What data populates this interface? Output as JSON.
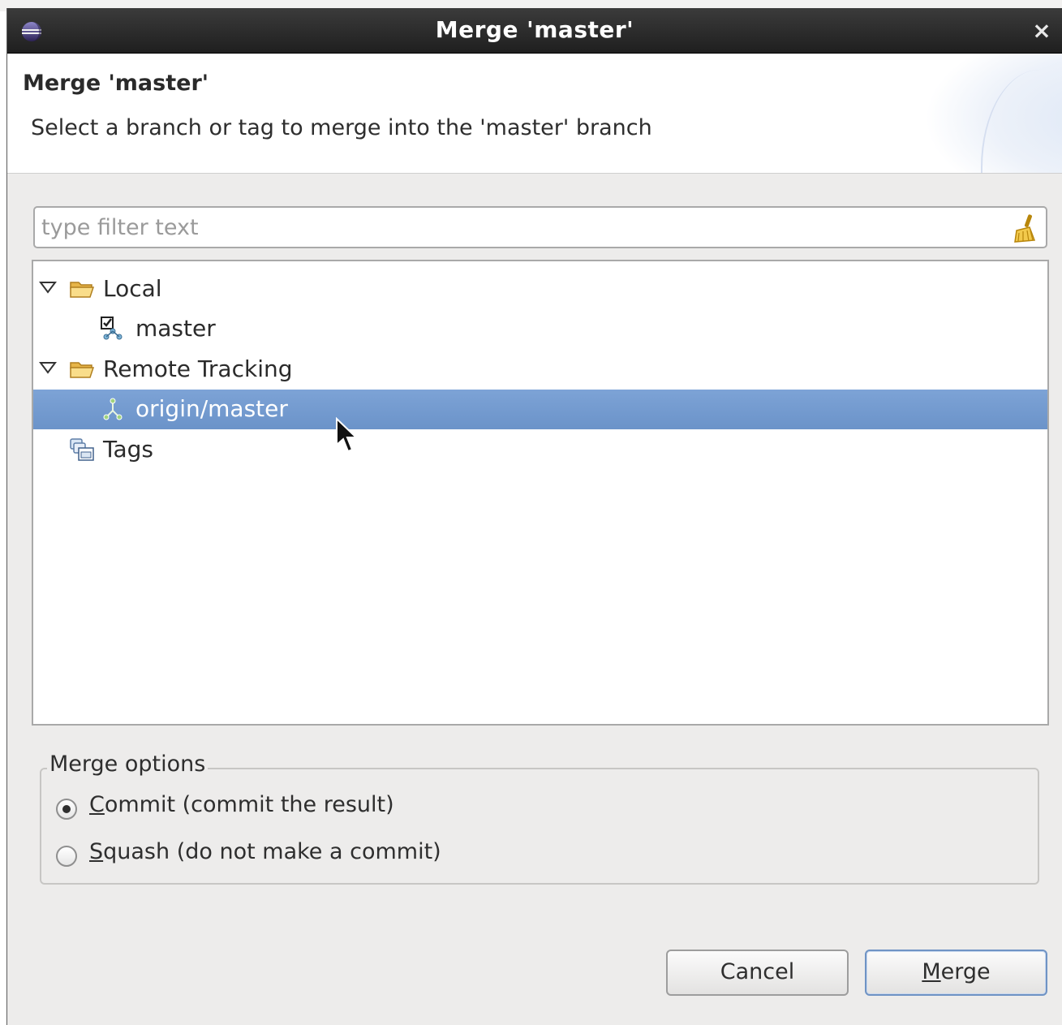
{
  "window": {
    "title": "Merge 'master'",
    "close_glyph": "×",
    "app_icon": "eclipse-icon"
  },
  "header": {
    "title": "Merge 'master'",
    "description": "Select a branch or tag to merge into the 'master' branch"
  },
  "filter": {
    "placeholder": "type filter text",
    "value": "",
    "clear_icon": "broom-icon"
  },
  "tree": {
    "nodes": [
      {
        "label": "Local",
        "icon": "folder-open-icon",
        "expanded": true,
        "level": 0
      },
      {
        "label": "master",
        "icon": "checked-out-branch-icon",
        "level": 1
      },
      {
        "label": "Remote Tracking",
        "icon": "folder-open-icon",
        "expanded": true,
        "level": 0
      },
      {
        "label": "origin/master",
        "icon": "remote-branch-icon",
        "level": 1,
        "selected": true
      },
      {
        "label": "Tags",
        "icon": "tags-icon",
        "level": 0
      }
    ]
  },
  "merge_options": {
    "legend": "Merge options",
    "commit": {
      "mnemonic": "C",
      "rest": "ommit (commit the result)",
      "checked": true
    },
    "squash": {
      "mnemonic": "S",
      "rest": "quash (do not make a commit)",
      "checked": false
    }
  },
  "buttons": {
    "cancel": "Cancel",
    "merge_mnemonic": "M",
    "merge_rest": "erge"
  },
  "colors": {
    "selection": "#7099cf",
    "titlebar": "#2a2a2a",
    "dialog_bg": "#edeceb"
  }
}
